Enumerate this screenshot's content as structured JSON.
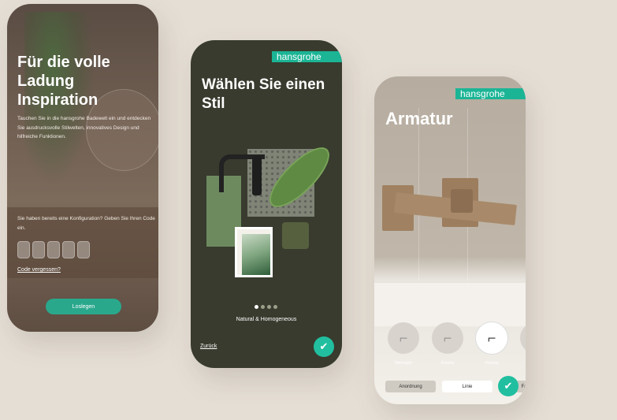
{
  "phone1": {
    "title": "Für die volle Ladung Inspiration",
    "description": "Tauchen Sie in die hansgrohe Badewelt ein und entdecken Sie ausdrucksvolle Stilwelten, innovatives Design und hilfreiche Funktionen.",
    "config_prompt": "Sie haben bereits eine Konfiguration? Geben Sie Ihren Code ein.",
    "code_boxes": [
      "",
      "",
      "",
      "",
      ""
    ],
    "forgot_link": "Code vergessen?",
    "start_button": "Loslegen"
  },
  "phone2": {
    "brand": "hansgrohe",
    "title": "Wählen Sie einen Stil",
    "style_caption": "Natural & Homogeneous",
    "carousel_active_index": 0,
    "carousel_count": 4,
    "back_link": "Zurück",
    "confirm_icon": "check-icon"
  },
  "phone3": {
    "brand": "hansgrohe",
    "title": "Armatur",
    "faucet_options": [
      {
        "label": "Metropol",
        "selected": false
      },
      {
        "label": "Finoris",
        "selected": false
      },
      {
        "label": "Vivenis",
        "selected": true
      },
      {
        "label": "T",
        "selected": false
      }
    ],
    "tabs": [
      {
        "label": "Anordnung",
        "active": false
      },
      {
        "label": "Linie",
        "active": true
      },
      {
        "label": "Fa",
        "active": false
      }
    ],
    "confirm_icon": "check-icon"
  },
  "colors": {
    "accent": "#1bb596",
    "dark_green": "#383b2e",
    "background": "#e5ded4"
  }
}
